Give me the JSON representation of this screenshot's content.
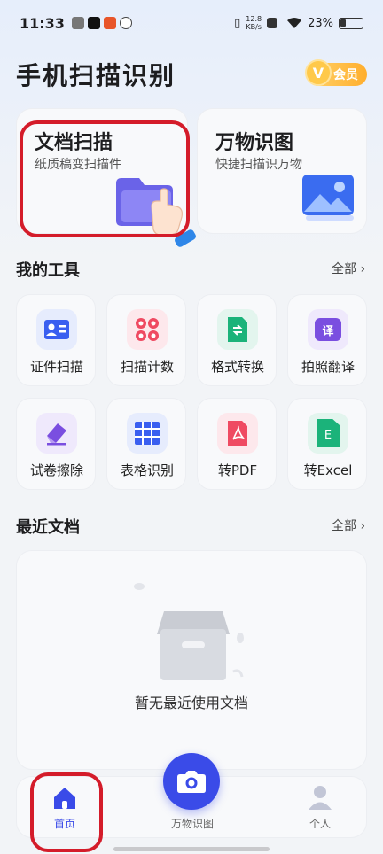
{
  "status_bar": {
    "time": "11:33",
    "speed_top": "12.8",
    "speed_unit": "KB/s",
    "battery": "23%"
  },
  "header": {
    "title": "手机扫描识别",
    "vip_label": "会员",
    "vip_mark": "V"
  },
  "features": [
    {
      "title": "文档扫描",
      "subtitle": "纸质稿变扫描件"
    },
    {
      "title": "万物识图",
      "subtitle": "快捷扫描识万物"
    }
  ],
  "tools_section": {
    "title": "我的工具",
    "all_label": "全部"
  },
  "tools": [
    {
      "label": "证件扫描"
    },
    {
      "label": "扫描计数"
    },
    {
      "label": "格式转换"
    },
    {
      "label": "拍照翻译",
      "icon_text": "译"
    },
    {
      "label": "试卷擦除"
    },
    {
      "label": "表格识别"
    },
    {
      "label": "转PDF"
    },
    {
      "label": "转Excel",
      "icon_text": "E"
    }
  ],
  "recent_section": {
    "title": "最近文档",
    "all_label": "全部",
    "empty_text": "暂无最近使用文档"
  },
  "nav": {
    "home": "首页",
    "scan": "万物识图",
    "profile": "个人"
  },
  "colors": {
    "accent": "#3a4be8",
    "highlight": "#d41c2a",
    "vip": "#ffae2d"
  }
}
